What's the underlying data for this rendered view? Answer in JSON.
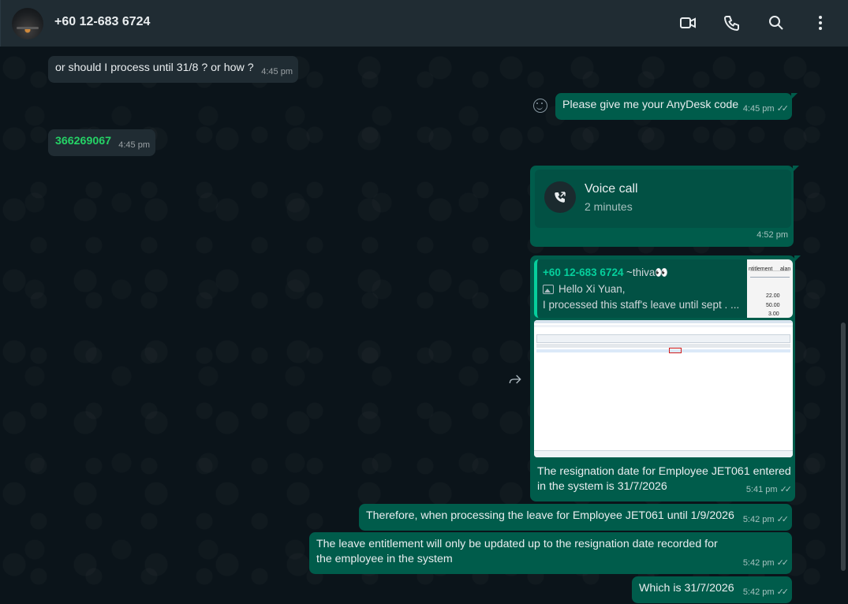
{
  "header": {
    "contact_name": "+60 12-683 6724",
    "icons": [
      "video-call-icon",
      "voice-call-icon",
      "search-icon",
      "menu-icon"
    ]
  },
  "messages": [
    {
      "id": "m1",
      "direction": "in",
      "text": "or should I process until 31/8 ? or how ?",
      "time": "4:45 pm"
    },
    {
      "id": "m2",
      "direction": "out",
      "text": "Please give me your AnyDesk code",
      "time": "4:45 pm",
      "status": "read"
    },
    {
      "id": "m3",
      "direction": "in",
      "text": "366269067",
      "time": "4:45 pm"
    },
    {
      "id": "m4",
      "direction": "out",
      "type": "call",
      "title": "Voice call",
      "subtitle": "2 minutes",
      "time": "4:52 pm"
    },
    {
      "id": "m5",
      "direction": "out",
      "type": "image-reply",
      "quote": {
        "author": "+60 12-683 6724",
        "alias": "~thiva👀",
        "line1": "Hello Xi Yuan,",
        "line2": "I processed this staff's leave until sept . ...",
        "thumb_header": "ntitlement",
        "thumb_header2": "alan",
        "thumb_values": [
          "22.00",
          "50.00",
          "3.00"
        ]
      },
      "caption": "The resignation date for Employee JET061 entered in the system is 31/7/2026",
      "time": "5:41 pm",
      "status": "read"
    },
    {
      "id": "m6",
      "direction": "out",
      "text": "Therefore, when processing the leave for Employee JET061 until 1/9/2026",
      "time": "5:42 pm",
      "status": "read"
    },
    {
      "id": "m7",
      "direction": "out",
      "text": "The leave entitlement will only be updated up to the resignation date recorded for the employee in the system",
      "time": "5:42 pm",
      "status": "read"
    },
    {
      "id": "m8",
      "direction": "out",
      "text": "Which is 31/7/2026",
      "time": "5:42 pm",
      "status": "read"
    }
  ],
  "colors": {
    "chat_bg": "#0b141a",
    "header_bg": "#202c33",
    "incoming_bubble": "#202c33",
    "outgoing_bubble": "#005c4b",
    "accent": "#06cf9c",
    "number_link": "#25d366"
  }
}
